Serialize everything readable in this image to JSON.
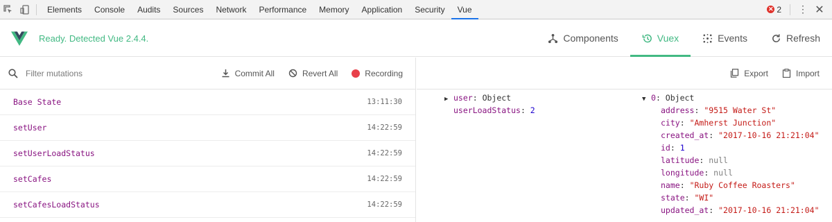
{
  "devtools": {
    "tabs": [
      "Elements",
      "Console",
      "Audits",
      "Sources",
      "Network",
      "Performance",
      "Memory",
      "Application",
      "Security",
      "Vue"
    ],
    "active_tab": "Vue",
    "error_count": "2"
  },
  "vue": {
    "status": "Ready. Detected Vue 2.4.4.",
    "nav": {
      "components": "Components",
      "vuex": "Vuex",
      "events": "Events",
      "refresh": "Refresh"
    },
    "accent_color": "#42b983"
  },
  "mutations_panel": {
    "filter_placeholder": "Filter mutations",
    "commit_all": "Commit All",
    "revert_all": "Revert All",
    "recording": "Recording",
    "items": [
      {
        "name": "Base State",
        "time": "13:11:30"
      },
      {
        "name": "setUser",
        "time": "14:22:59"
      },
      {
        "name": "setUserLoadStatus",
        "time": "14:22:59"
      },
      {
        "name": "setCafes",
        "time": "14:22:59"
      },
      {
        "name": "setCafesLoadStatus",
        "time": "14:22:59"
      }
    ]
  },
  "state_panel": {
    "export": "Export",
    "import": "Import",
    "user_key": "user",
    "user_type": "Object",
    "user_load_status_key": "userLoadStatus",
    "user_load_status_value": "2",
    "cafe_key": "0",
    "cafe_type": "Object",
    "cafe_fields": [
      {
        "key": "address",
        "value": "\"9515 Water St\"",
        "kind": "str"
      },
      {
        "key": "city",
        "value": "\"Amherst Junction\"",
        "kind": "str"
      },
      {
        "key": "created_at",
        "value": "\"2017-10-16 21:21:04\"",
        "kind": "str"
      },
      {
        "key": "id",
        "value": "1",
        "kind": "num"
      },
      {
        "key": "latitude",
        "value": "null",
        "kind": "nul"
      },
      {
        "key": "longitude",
        "value": "null",
        "kind": "nul"
      },
      {
        "key": "name",
        "value": "\"Ruby Coffee Roasters\"",
        "kind": "str"
      },
      {
        "key": "state",
        "value": "\"WI\"",
        "kind": "str"
      },
      {
        "key": "updated_at",
        "value": "\"2017-10-16 21:21:04\"",
        "kind": "str"
      }
    ]
  }
}
